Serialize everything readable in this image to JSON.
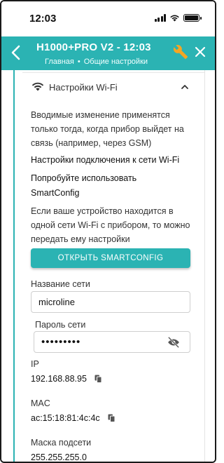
{
  "status_bar": {
    "time": "12:03",
    "icons": [
      "signal-icon",
      "wifi-icon",
      "battery-icon"
    ]
  },
  "app_bar": {
    "title": "H1000+PRO V2 - 12:03",
    "breadcrumbs": [
      "Главная",
      "Общие настройки"
    ],
    "breadcrumb_separator": "•",
    "back_icon": "chevron-left-icon",
    "wrench_icon": "wrench-icon",
    "close_icon": "close-icon",
    "accent_color": "#2bb3b3"
  },
  "section": {
    "title": "Настройки Wi-Fi",
    "icon": "wifi-icon",
    "collapse_icon": "chevron-up-icon",
    "notice": "Вводимые изменение применятся только тогда, когда прибор выйдет на связь (например, через GSM)",
    "connection_heading": "Настройки подключения к сети Wi-Fi",
    "smartconfig_hint_line1": "Попробуйте использовать",
    "smartconfig_hint_line2": "SmartConfig",
    "smartconfig_desc": "Если ваше устройство находится в одной сети Wi-Fi с прибором, то можно передать ему настройки",
    "smartconfig_button": "ОТКРЫТЬ SMARTCONFIG"
  },
  "form": {
    "network_name_label": "Название сети",
    "network_name_value": "microline",
    "password_label": "Пароль сети",
    "password_value": "•••••••••",
    "password_toggle_icon": "eye-off-icon"
  },
  "info": {
    "ip_label": "IP",
    "ip_value": "192.168.88.95",
    "mac_label": "MAC",
    "mac_value": "ac:15:18:81:4c:4c",
    "mask_label": "Маска подсети",
    "mask_value": "255.255.255.0",
    "copy_icon": "copy-icon"
  }
}
